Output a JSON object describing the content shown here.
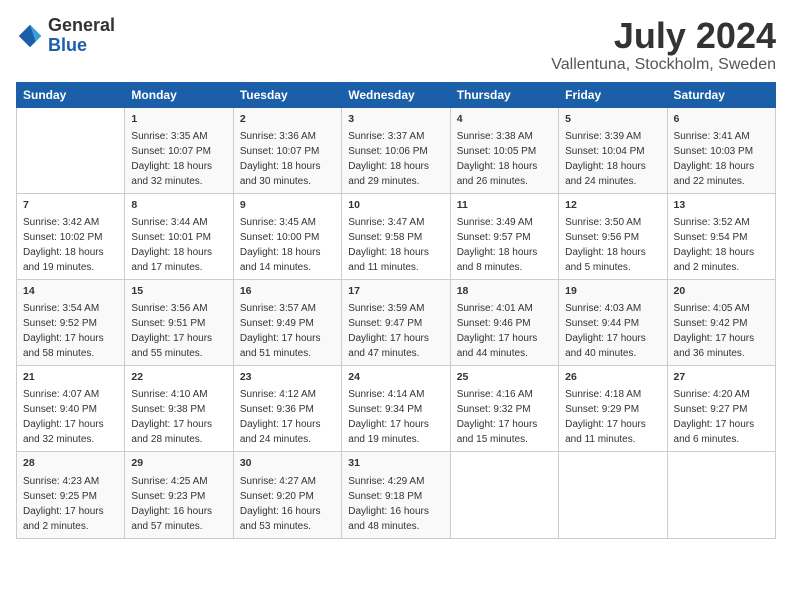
{
  "logo": {
    "general": "General",
    "blue": "Blue"
  },
  "title": "July 2024",
  "location": "Vallentuna, Stockholm, Sweden",
  "days_of_week": [
    "Sunday",
    "Monday",
    "Tuesday",
    "Wednesday",
    "Thursday",
    "Friday",
    "Saturday"
  ],
  "weeks": [
    [
      {
        "day": "",
        "content": ""
      },
      {
        "day": "1",
        "content": "Sunrise: 3:35 AM\nSunset: 10:07 PM\nDaylight: 18 hours\nand 32 minutes."
      },
      {
        "day": "2",
        "content": "Sunrise: 3:36 AM\nSunset: 10:07 PM\nDaylight: 18 hours\nand 30 minutes."
      },
      {
        "day": "3",
        "content": "Sunrise: 3:37 AM\nSunset: 10:06 PM\nDaylight: 18 hours\nand 29 minutes."
      },
      {
        "day": "4",
        "content": "Sunrise: 3:38 AM\nSunset: 10:05 PM\nDaylight: 18 hours\nand 26 minutes."
      },
      {
        "day": "5",
        "content": "Sunrise: 3:39 AM\nSunset: 10:04 PM\nDaylight: 18 hours\nand 24 minutes."
      },
      {
        "day": "6",
        "content": "Sunrise: 3:41 AM\nSunset: 10:03 PM\nDaylight: 18 hours\nand 22 minutes."
      }
    ],
    [
      {
        "day": "7",
        "content": "Sunrise: 3:42 AM\nSunset: 10:02 PM\nDaylight: 18 hours\nand 19 minutes."
      },
      {
        "day": "8",
        "content": "Sunrise: 3:44 AM\nSunset: 10:01 PM\nDaylight: 18 hours\nand 17 minutes."
      },
      {
        "day": "9",
        "content": "Sunrise: 3:45 AM\nSunset: 10:00 PM\nDaylight: 18 hours\nand 14 minutes."
      },
      {
        "day": "10",
        "content": "Sunrise: 3:47 AM\nSunset: 9:58 PM\nDaylight: 18 hours\nand 11 minutes."
      },
      {
        "day": "11",
        "content": "Sunrise: 3:49 AM\nSunset: 9:57 PM\nDaylight: 18 hours\nand 8 minutes."
      },
      {
        "day": "12",
        "content": "Sunrise: 3:50 AM\nSunset: 9:56 PM\nDaylight: 18 hours\nand 5 minutes."
      },
      {
        "day": "13",
        "content": "Sunrise: 3:52 AM\nSunset: 9:54 PM\nDaylight: 18 hours\nand 2 minutes."
      }
    ],
    [
      {
        "day": "14",
        "content": "Sunrise: 3:54 AM\nSunset: 9:52 PM\nDaylight: 17 hours\nand 58 minutes."
      },
      {
        "day": "15",
        "content": "Sunrise: 3:56 AM\nSunset: 9:51 PM\nDaylight: 17 hours\nand 55 minutes."
      },
      {
        "day": "16",
        "content": "Sunrise: 3:57 AM\nSunset: 9:49 PM\nDaylight: 17 hours\nand 51 minutes."
      },
      {
        "day": "17",
        "content": "Sunrise: 3:59 AM\nSunset: 9:47 PM\nDaylight: 17 hours\nand 47 minutes."
      },
      {
        "day": "18",
        "content": "Sunrise: 4:01 AM\nSunset: 9:46 PM\nDaylight: 17 hours\nand 44 minutes."
      },
      {
        "day": "19",
        "content": "Sunrise: 4:03 AM\nSunset: 9:44 PM\nDaylight: 17 hours\nand 40 minutes."
      },
      {
        "day": "20",
        "content": "Sunrise: 4:05 AM\nSunset: 9:42 PM\nDaylight: 17 hours\nand 36 minutes."
      }
    ],
    [
      {
        "day": "21",
        "content": "Sunrise: 4:07 AM\nSunset: 9:40 PM\nDaylight: 17 hours\nand 32 minutes."
      },
      {
        "day": "22",
        "content": "Sunrise: 4:10 AM\nSunset: 9:38 PM\nDaylight: 17 hours\nand 28 minutes."
      },
      {
        "day": "23",
        "content": "Sunrise: 4:12 AM\nSunset: 9:36 PM\nDaylight: 17 hours\nand 24 minutes."
      },
      {
        "day": "24",
        "content": "Sunrise: 4:14 AM\nSunset: 9:34 PM\nDaylight: 17 hours\nand 19 minutes."
      },
      {
        "day": "25",
        "content": "Sunrise: 4:16 AM\nSunset: 9:32 PM\nDaylight: 17 hours\nand 15 minutes."
      },
      {
        "day": "26",
        "content": "Sunrise: 4:18 AM\nSunset: 9:29 PM\nDaylight: 17 hours\nand 11 minutes."
      },
      {
        "day": "27",
        "content": "Sunrise: 4:20 AM\nSunset: 9:27 PM\nDaylight: 17 hours\nand 6 minutes."
      }
    ],
    [
      {
        "day": "28",
        "content": "Sunrise: 4:23 AM\nSunset: 9:25 PM\nDaylight: 17 hours\nand 2 minutes."
      },
      {
        "day": "29",
        "content": "Sunrise: 4:25 AM\nSunset: 9:23 PM\nDaylight: 16 hours\nand 57 minutes."
      },
      {
        "day": "30",
        "content": "Sunrise: 4:27 AM\nSunset: 9:20 PM\nDaylight: 16 hours\nand 53 minutes."
      },
      {
        "day": "31",
        "content": "Sunrise: 4:29 AM\nSunset: 9:18 PM\nDaylight: 16 hours\nand 48 minutes."
      },
      {
        "day": "",
        "content": ""
      },
      {
        "day": "",
        "content": ""
      },
      {
        "day": "",
        "content": ""
      }
    ]
  ],
  "colors": {
    "header_bg": "#1a5fa8",
    "header_text": "#ffffff",
    "odd_row": "#f9f9f9",
    "even_row": "#ffffff"
  }
}
